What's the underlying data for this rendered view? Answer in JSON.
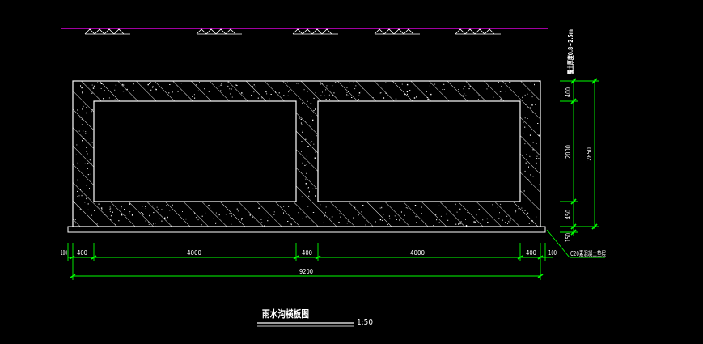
{
  "drawing": {
    "title": "雨水沟横板图",
    "scale": "1:50",
    "ground_note": "覆土厚度0.8~2.5m",
    "cushion_note": "C20素混凝土垫层",
    "horizontal_dims": {
      "segments": [
        "100",
        "400",
        "4000",
        "400",
        "4000",
        "400",
        "100"
      ],
      "total": "9200"
    },
    "vertical_dims": {
      "segments": [
        "400",
        "2000",
        "450",
        "150"
      ],
      "total": "2850"
    }
  },
  "colors": {
    "background": "#000000",
    "outline": "#ffffff",
    "dimension": "#00ff00",
    "ground_line": "#ff00ff",
    "text": "#ffffff"
  }
}
